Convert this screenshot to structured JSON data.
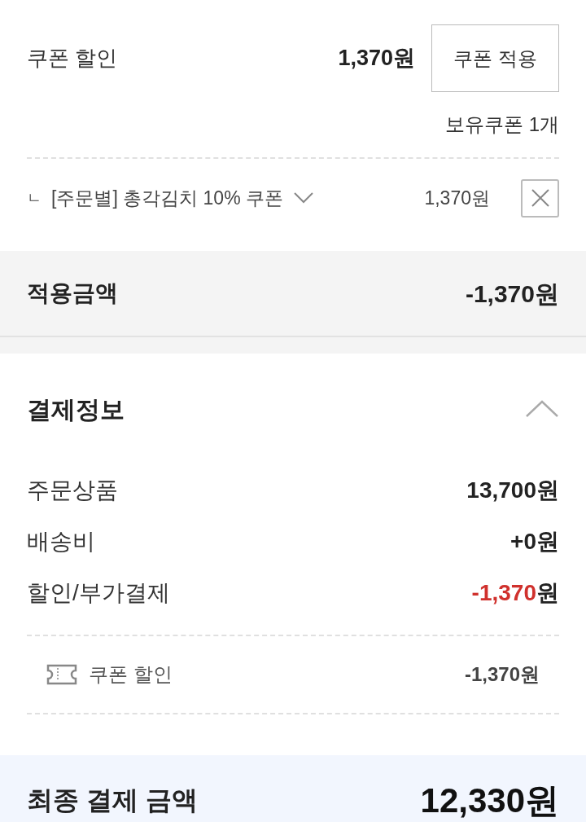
{
  "coupon_discount": {
    "label": "쿠폰 할인",
    "amount": "1,370원",
    "apply_button": "쿠폰 적용",
    "owned": "보유쿠폰 1개"
  },
  "applied_coupon": {
    "prefix": "ㄴ",
    "name": "[주문별] 총각김치 10% 쿠폰",
    "amount": "1,370원"
  },
  "applied_total": {
    "label": "적용금액",
    "amount": "-1,370원"
  },
  "payment_info": {
    "title": "결제정보",
    "expanded": true,
    "rows": [
      {
        "label": "주문상품",
        "value": "13,700",
        "unit": "원",
        "highlight": false
      },
      {
        "label": "배송비",
        "value": "+0",
        "unit": "원",
        "highlight": false
      },
      {
        "label": "할인/부가결제",
        "value": "-1,370",
        "unit": "원",
        "highlight": true
      }
    ],
    "details": [
      {
        "label": "쿠폰 할인",
        "amount": "-1,370원"
      }
    ]
  },
  "final": {
    "label": "최종 결제 금액",
    "amount": "12,330원"
  }
}
